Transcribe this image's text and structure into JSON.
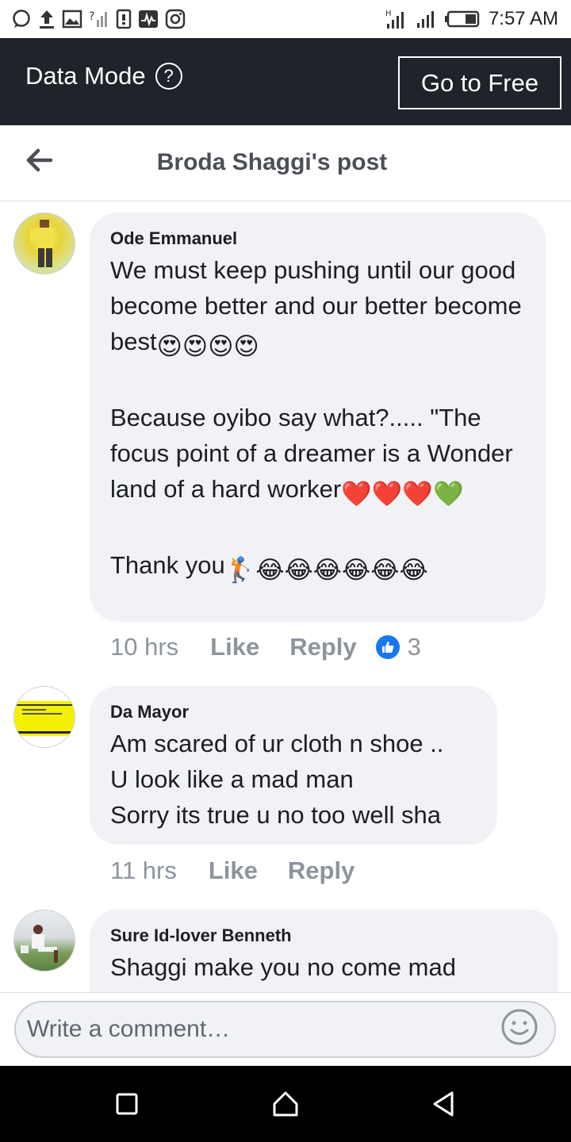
{
  "status_bar": {
    "time": "7:57 AM",
    "left_icons": [
      "chat-bubble-icon",
      "upload-icon",
      "image-icon",
      "no-signal-icon",
      "sim-icon",
      "activity-icon",
      "instagram-icon"
    ],
    "right_icons": [
      "signal-h-icon",
      "signal-bars-icon",
      "battery-icon"
    ]
  },
  "data_bar": {
    "title": "Data Mode",
    "help_icon": "?",
    "go_free_label": "Go to Free",
    "background": "#1f232a"
  },
  "header": {
    "title": "Broda Shaggi's post",
    "back_icon": "back-arrow-icon"
  },
  "comments": [
    {
      "author": "Ode Emmanuel",
      "paragraphs": [
        "We must keep pushing until our good become better and our better become best",
        "Because oyibo say what?..... \"The focus point of a dreamer is a Wonder land of a hard worker",
        "Thank you"
      ],
      "emoji_1": "😍😍😍😍",
      "emoji_2": "❤️❤️❤️💚",
      "emoji_3": "🏌😂😂😂😂😂😂",
      "time": "10 hrs",
      "like": "Like",
      "reply": "Reply",
      "reactions": "3"
    },
    {
      "author": "Da Mayor",
      "text": "Am scared of ur cloth n shoe ..\nU look like a mad man\nSorry its true u no too well sha",
      "time": "11 hrs",
      "like": "Like",
      "reply": "Reply"
    },
    {
      "author": "Sure Id-lover Benneth",
      "text": "Shaggi make you no come mad"
    }
  ],
  "composer": {
    "placeholder": "Write a comment…",
    "emoji_icon": "smiley-icon"
  },
  "nav_bar": {
    "buttons": [
      "recent-apps-icon",
      "home-icon",
      "back-icon"
    ]
  },
  "colors": {
    "accent": "#1877f2",
    "bubble": "#f0f2f5",
    "muted_text": "#8d949e"
  }
}
